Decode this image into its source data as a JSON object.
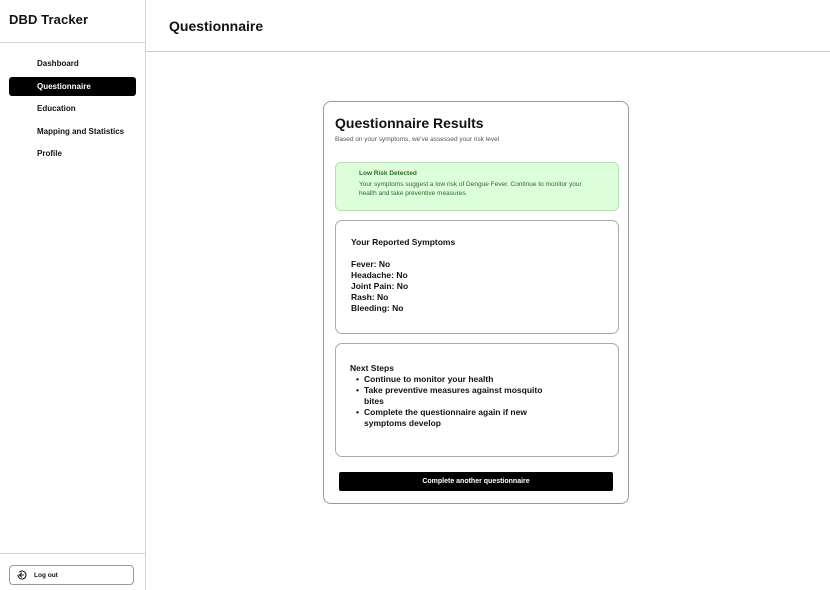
{
  "app": {
    "title": "DBD Tracker"
  },
  "sidebar": {
    "items": [
      {
        "label": "Dashboard",
        "active": false
      },
      {
        "label": "Questionnaire",
        "active": true
      },
      {
        "label": "Education",
        "active": false
      },
      {
        "label": "Mapping and Statistics",
        "active": false
      },
      {
        "label": "Profile",
        "active": false
      }
    ],
    "logout": {
      "label": "Log out",
      "icon": "logout-icon"
    }
  },
  "header": {
    "title": "Questionnaire"
  },
  "results": {
    "title": "Questionnaire Results",
    "subtitle": "Based on your symptoms, we've assessed your risk level",
    "alert": {
      "title": "Low Risk Detected",
      "text": "Your symptoms suggest a low risk of Dengue Fever. Continue to monitor your health and take preventive measures.",
      "color": "#dcffd9"
    },
    "symptoms": {
      "heading": "Your Reported Symptoms",
      "items": [
        "Fever: No",
        "Headache: No",
        "Joint Pain: No",
        "Rash: No",
        "Bleeding: No"
      ]
    },
    "next_steps": {
      "heading": "Next Steps",
      "items": [
        "Continue to monitor your health",
        "Take preventive measures against mosquito bites",
        "Complete the questionnaire again if new symptoms develop"
      ]
    },
    "cta_label": "Complete another questionnaire"
  }
}
